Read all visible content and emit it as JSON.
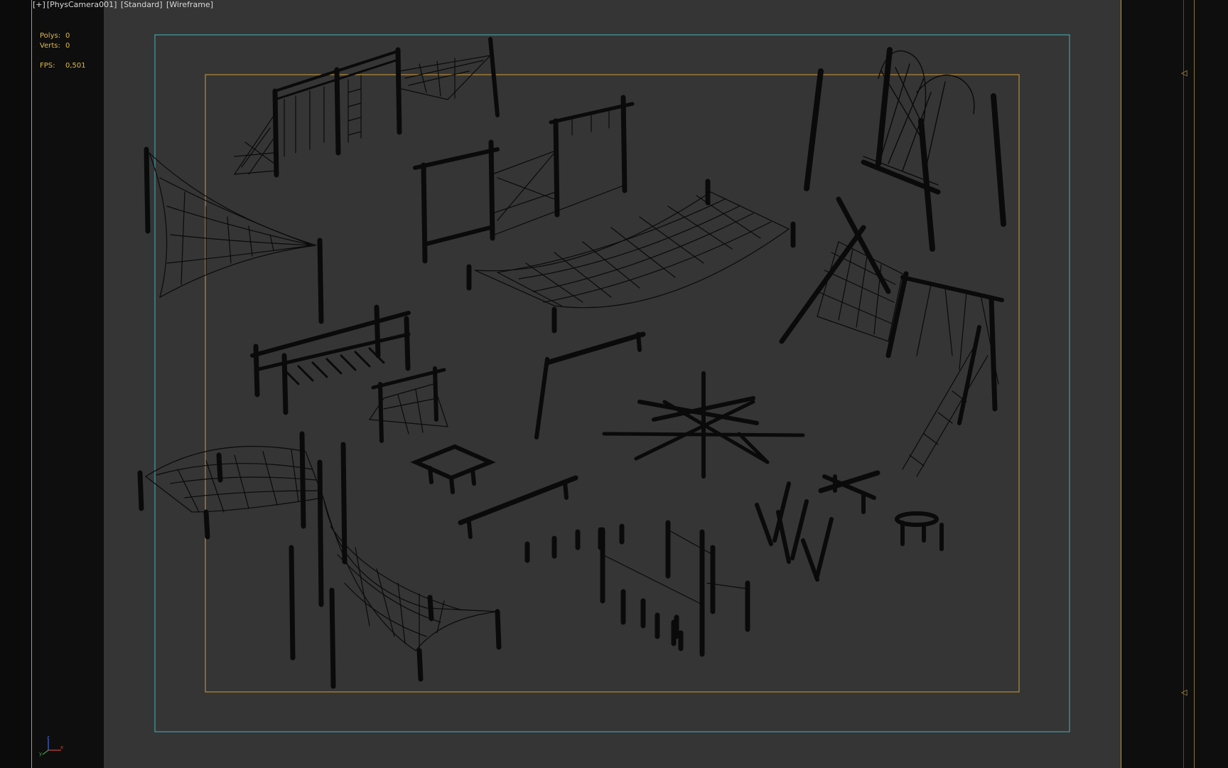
{
  "viewport": {
    "label_parts": [
      "[+]",
      "[PhysCamera001]",
      "[Standard]",
      "[Wireframe]"
    ]
  },
  "stats": {
    "polys_label": "Polys:",
    "polys_value": "0",
    "verts_label": "Verts:",
    "verts_value": "0",
    "fps_label": "FPS:",
    "fps_value": "0,501"
  },
  "gizmo": {
    "x": "x",
    "y": "y",
    "z": "z"
  },
  "colors": {
    "background": "#353535",
    "safe_frame": "#3fb3c0",
    "render_frame": "#d39a35",
    "wireframe": "#0a0a0a",
    "stats_text": "#e0b94a"
  },
  "icons": [
    "viewport-menu-icon",
    "axis-gizmo-icon",
    "frame-marker-icon"
  ]
}
